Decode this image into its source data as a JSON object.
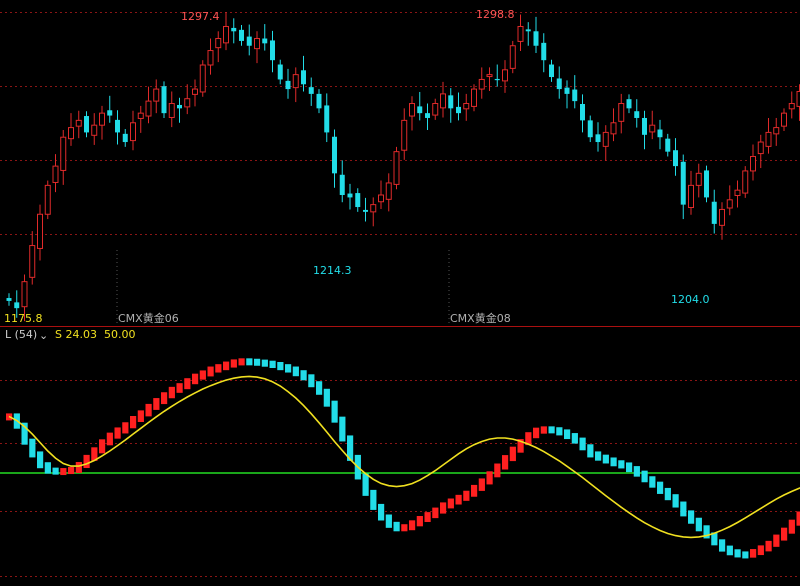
{
  "chart_data": [
    {
      "type": "candlestick",
      "instrument_markers": [
        "CMX黄金06",
        "CMX黄金08"
      ],
      "annotations": [
        {
          "label": "1297.4",
          "price": 1297.4,
          "kind": "high"
        },
        {
          "label": "1298.8",
          "price": 1298.8,
          "kind": "high"
        },
        {
          "label": "1214.3",
          "price": 1214.3,
          "kind": "low"
        },
        {
          "label": "1204.0",
          "price": 1204.0,
          "kind": "low"
        },
        {
          "label": "1175.8",
          "price": 1175.8,
          "kind": "low"
        }
      ],
      "ylim": [
        1170,
        1305
      ],
      "grid": true,
      "colors": {
        "up": "#e02a2a",
        "down": "#22dde8"
      },
      "close": [
        1180,
        1177,
        1188,
        1203,
        1216,
        1228,
        1236,
        1248,
        1252,
        1255,
        1250,
        1253,
        1258,
        1257,
        1250,
        1246,
        1254,
        1258,
        1263,
        1268,
        1258,
        1262,
        1260,
        1264,
        1268,
        1278,
        1284,
        1289,
        1294,
        1292,
        1288,
        1286,
        1289,
        1287,
        1280,
        1272,
        1268,
        1274,
        1270,
        1266,
        1260,
        1250,
        1233,
        1224,
        1223,
        1219,
        1217,
        1220,
        1224,
        1229,
        1242,
        1255,
        1262,
        1258,
        1256,
        1262,
        1266,
        1260,
        1258,
        1262,
        1268,
        1272,
        1274,
        1272,
        1276,
        1286,
        1294,
        1292,
        1286,
        1280,
        1273,
        1268,
        1266,
        1263,
        1255,
        1248,
        1246,
        1250,
        1254,
        1262,
        1260,
        1256,
        1249,
        1253,
        1248,
        1242,
        1236,
        1220,
        1228,
        1233,
        1223,
        1212,
        1218,
        1222,
        1226,
        1234,
        1240,
        1246,
        1250,
        1252,
        1258,
        1262,
        1267,
        1270
      ]
    },
    {
      "type": "oscillator",
      "legend": [
        {
          "name": "L (54)",
          "color": "#cccccc"
        },
        {
          "name": "S 24.03",
          "color": "#f0e020"
        },
        {
          "name": "50.00",
          "color": "#f0e020"
        }
      ],
      "ylim": [
        0,
        100
      ],
      "reference_line": 50,
      "colors": {
        "rising": "#ff2020",
        "falling": "#22dde8",
        "signal": "#f0e020",
        "reference": "#22dd22"
      },
      "osc": [
        76.2,
        71.9,
        64.5,
        58.6,
        53.6,
        51.1,
        50.9,
        50.9,
        51.4,
        53.7,
        57.0,
        60.5,
        64.2,
        67.3,
        69.7,
        72.1,
        75.0,
        77.6,
        80.6,
        83.3,
        86.0,
        88.5,
        90.2,
        92.5,
        94.6,
        96.1,
        97.9,
        99.0,
        100.2,
        101.2,
        101.7,
        101.5,
        101.1,
        100.6,
        100.0,
        99.0,
        97.9,
        96.2,
        94.3,
        91.1,
        87.6,
        82.1,
        74.7,
        66.0,
        57.0,
        48.4,
        40.8,
        34.3,
        29.4,
        26.0,
        24.4,
        24.9,
        26.7,
        28.7,
        30.5,
        32.6,
        35.0,
        36.8,
        38.5,
        40.4,
        43.1,
        46.1,
        49.4,
        53.0,
        56.9,
        60.8,
        64.3,
        67.5,
        69.6,
        70.2,
        69.8,
        68.8,
        67.1,
        65.0,
        61.9,
        58.6,
        57.1,
        55.8,
        54.5,
        53.5,
        51.8,
        49.7,
        47.1,
        44.6,
        41.7,
        38.8,
        35.4,
        31.3,
        27.9,
        24.4,
        21.1,
        17.9,
        15.0,
        13.3,
        12.3,
        12.2,
        13.4,
        15.1,
        17.2,
        20.1,
        23.3,
        27.0,
        30.8,
        34.5
      ],
      "signal": [
        76.2,
        74.3,
        71.5,
        68.0,
        64.1,
        60.2,
        56.9,
        54.4,
        53.2,
        53.2,
        54.2,
        55.8,
        57.9,
        60.2,
        62.7,
        65.3,
        68.0,
        70.7,
        73.4,
        76.0,
        78.5,
        80.9,
        83.1,
        85.2,
        87.1,
        88.9,
        90.4,
        91.8,
        93.0,
        93.9,
        94.5,
        94.7,
        94.4,
        93.6,
        92.2,
        90.3,
        87.7,
        84.7,
        81.3,
        77.4,
        73.3,
        69.0,
        64.6,
        60.4,
        56.4,
        52.8,
        49.7,
        47.1,
        45.2,
        44.1,
        43.7,
        44.1,
        45.1,
        46.7,
        48.8,
        51.1,
        53.7,
        56.3,
        58.9,
        61.2,
        63.1,
        64.6,
        65.7,
        66.2,
        66.2,
        65.7,
        64.7,
        63.4,
        61.8,
        59.9,
        57.8,
        55.6,
        53.1,
        50.5,
        47.9,
        45.1,
        42.3,
        39.5,
        36.8,
        34.1,
        31.6,
        29.2,
        27.0,
        25.1,
        23.4,
        22.0,
        21.0,
        20.4,
        20.2,
        20.4,
        21.0,
        22.1,
        23.5,
        25.2,
        27.1,
        29.2,
        31.4,
        33.6,
        35.8,
        37.9,
        39.8,
        41.5,
        43.0,
        44.2
      ]
    }
  ]
}
